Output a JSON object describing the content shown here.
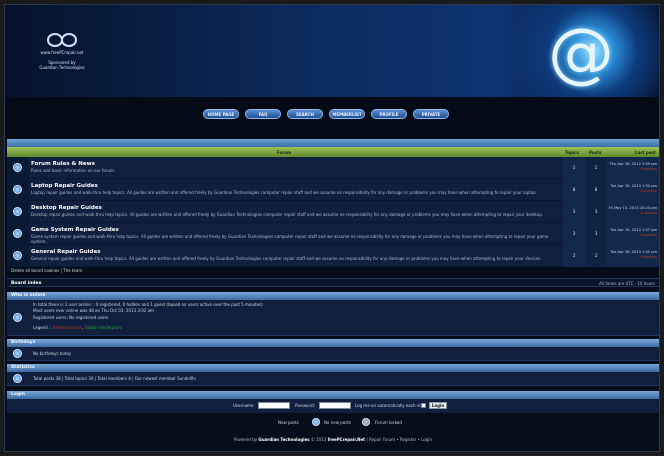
{
  "header": {
    "logo_url_text": "www.freePCrepair.net",
    "sponsored_by": "Sponsored by",
    "sponsor": "Guardian Technologies",
    "at_symbol": "@"
  },
  "nav": {
    "items": [
      "HOME PAGE",
      "FAQ",
      "SEARCH",
      "MEMBERLIST",
      "PROFILE",
      "PRIVATE"
    ]
  },
  "forum_table": {
    "header": {
      "forum": "Forum",
      "topics": "Topics",
      "posts": "Posts",
      "last_post": "Last post"
    },
    "rows": [
      {
        "title": "Forum Rules & News",
        "desc": "Rules and basic information on our forum.",
        "topics": "1",
        "posts": "1",
        "last_date": "Thu Apr 16, 2012 2:09 pm",
        "last_user": "Guardian"
      },
      {
        "title": "Laptop Repair Guides",
        "desc": "Laptop repair guides and walk-thru help topics. All guides are written and offered freely by Guardian Technologies computer repair staff and we assume no responsibility for any damage or problems you may have when attempting to repair your laptop.",
        "topics": "8",
        "posts": "8",
        "last_date": "Tue Apr 16, 2013 1:54 pm",
        "last_user": "Guardian"
      },
      {
        "title": "Desktop Repair Guides",
        "desc": "Desktop repair guides and walk-thru help topics. All guides are written and offered freely by Guardian Technologies computer repair staff and we assume no responsibility for any damage or problems you may have when attempting to repair your desktop.",
        "topics": "3",
        "posts": "3",
        "last_date": "Fri May 10, 2013 10:24 am",
        "last_user": "Guardian"
      },
      {
        "title": "Game System Repair Guides",
        "desc": "Game system repair guides and walk-thru help topics. All guides are written and offered freely by Guardian Technologies computer repair staff and we assume no responsibility for any damage or problems you may have when attempting to repair your game system.",
        "topics": "3",
        "posts": "3",
        "last_date": "Tue Apr 16, 2013 1:57 pm",
        "last_user": "Guardian"
      },
      {
        "title": "General Repair Guides",
        "desc": "General repair guides and walk-thru help topics. All guides are written and offered freely by Guardian Technologies computer repair staff and we assume no responsibility for any damage or problems you may have when attempting to repair your devices.",
        "topics": "2",
        "posts": "2",
        "last_date": "Tue Apr 16, 2013 1:45 pm",
        "last_user": "Guardian"
      }
    ]
  },
  "below": {
    "delete_cookies": "Delete all board cookies",
    "sep": " | ",
    "team": "The team"
  },
  "index_bar": {
    "left": "Board index",
    "right": "All times are UTC - 10 hours"
  },
  "who_online": {
    "title": "Who is online",
    "line1": "In total there is 1 user online :: 0 registered, 0 hidden and 1 guest (based on users active over the past 5 minutes)",
    "line2": "Most users ever online was 48 on Thu Oct 03, 2013 3:02 am",
    "line3": "Registered users: No registered users",
    "legend_label": "Legend :: ",
    "legend_admin": "Administrators",
    "legend_sep": ", ",
    "legend_mod": "Global moderators"
  },
  "birthdays": {
    "title": "Birthdays",
    "text": "No birthdays today"
  },
  "statistics": {
    "title": "Statistics",
    "text": "Total posts 38 | Total topics 30 | Total members 4 | Our newest member Sundolfin"
  },
  "login": {
    "title": "Login",
    "username_label": "Username:",
    "password_label": "Password:",
    "remember_label": "Log me on automatically each visit",
    "button": "Login"
  },
  "legend_icons": {
    "new_posts": "New posts",
    "no_new_posts": "No new posts",
    "locked": "Forum locked"
  },
  "footer": {
    "prefix": "Powered by ",
    "company": "Guardian Technologies",
    "middle": " © 2013 ",
    "site": "freePCrepair.Net",
    "links": " | Repair forum • Register • Login"
  }
}
